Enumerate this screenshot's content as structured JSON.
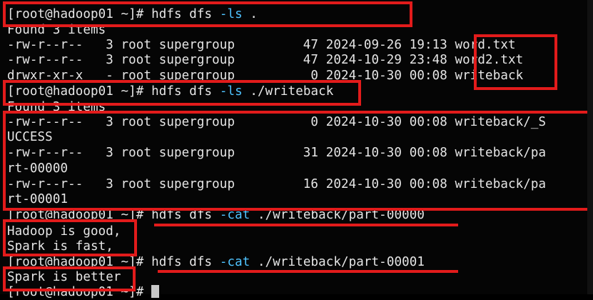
{
  "terminal": {
    "lines": [
      {
        "prompt": "[root@hadoop01 ~]# ",
        "cmd": "hdfs dfs ",
        "flag": "-ls",
        "args": " ."
      },
      {
        "text": "Found 3 items"
      },
      {
        "text": "-rw-r--r--   3 root supergroup         47 2024-09-26 19:13 word.txt"
      },
      {
        "text": "-rw-r--r--   3 root supergroup         47 2024-10-29 23:48 word2.txt"
      },
      {
        "text": "drwxr-xr-x   - root supergroup          0 2024-10-30 00:08 writeback"
      },
      {
        "prompt": "[root@hadoop01 ~]# ",
        "cmd": "hdfs dfs ",
        "flag": "-ls",
        "args": " ./writeback"
      },
      {
        "text": "Found 3 items"
      },
      {
        "text": "-rw-r--r--   3 root supergroup          0 2024-10-30 00:08 writeback/_S"
      },
      {
        "text": "UCCESS"
      },
      {
        "text": "-rw-r--r--   3 root supergroup         31 2024-10-30 00:08 writeback/pa"
      },
      {
        "text": "rt-00000"
      },
      {
        "text": "-rw-r--r--   3 root supergroup         16 2024-10-30 00:08 writeback/pa"
      },
      {
        "text": "rt-00001"
      },
      {
        "prompt": "[root@hadoop01 ~]# ",
        "cmd": "hdfs dfs ",
        "flag": "-cat",
        "args": " ./writeback/part-00000"
      },
      {
        "text": "Hadoop is good,"
      },
      {
        "text": "Spark is fast,"
      },
      {
        "prompt": "[root@hadoop01 ~]# ",
        "cmd": "hdfs dfs ",
        "flag": "-cat",
        "args": " ./writeback/part-00001"
      },
      {
        "text": "Spark is better"
      },
      {
        "prompt": "[root@hadoop01 ~]# ",
        "cmd": "",
        "flag": "",
        "args": ""
      }
    ]
  },
  "colors": {
    "background": "#050505",
    "text": "#e6e6e6",
    "flag": "#4fc3ff",
    "annotation": "#e21b1b"
  }
}
